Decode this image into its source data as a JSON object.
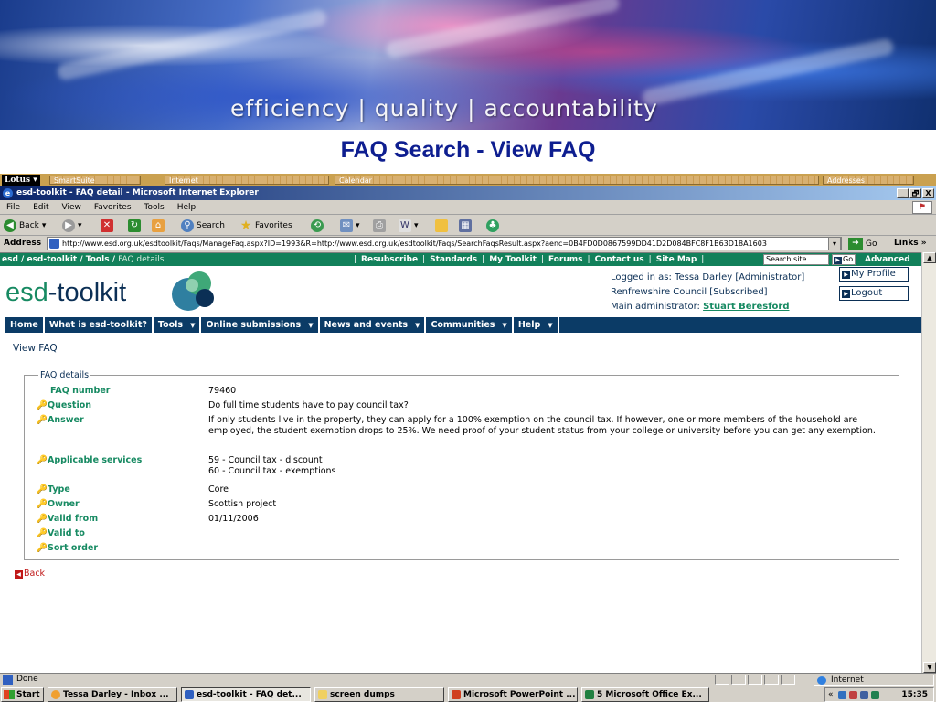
{
  "slide": {
    "tagline": "efficiency | quality | accountability",
    "title": "FAQ Search - View FAQ"
  },
  "lotus_bar": {
    "menu_label": "Lotus",
    "segments": [
      "SmartSuite",
      "Internet",
      "Calendar",
      "Addresses"
    ]
  },
  "window": {
    "title": "esd-toolkit - FAQ detail - Microsoft Internet Explorer",
    "buttons": [
      "_",
      "🗗",
      "X"
    ]
  },
  "menu": [
    "File",
    "Edit",
    "View",
    "Favorites",
    "Tools",
    "Help"
  ],
  "toolbar": {
    "back_label": "Back",
    "search_label": "Search",
    "favorites_label": "Favorites"
  },
  "address": {
    "label": "Address",
    "url": "http://www.esd.org.uk/esdtoolkit/Faqs/ManageFaq.aspx?ID=1993&R=http://www.esd.org.uk/esdtoolkit/Faqs/SearchFaqsResult.aspx?aenc=0B4FD0D0867599DD41D2D084BFC8F1B63D18A1603",
    "go_label": "Go",
    "links_label": "Links"
  },
  "site": {
    "breadcrumb": {
      "esd": "esd",
      "toolkit": "esd-toolkit",
      "tools": "Tools",
      "current": "FAQ details"
    },
    "top_links": [
      "Resubscribe",
      "Standards",
      "My Toolkit",
      "Forums",
      "Contact us",
      "Site Map"
    ],
    "search_placeholder": "Search site",
    "search_go": "Go",
    "advanced": "Advanced",
    "logo_prefix": "esd",
    "logo_suffix": "-toolkit",
    "logged_in": "Logged in as: Tessa Darley  [Administrator]",
    "council": "Renfrewshire Council  [Subscribed]",
    "main_admin_label": "Main administrator:",
    "main_admin_name": "Stuart Beresford",
    "my_profile": "My Profile",
    "logout": "Logout",
    "nav": [
      {
        "label": "Home",
        "dropdown": false
      },
      {
        "label": "What is esd-toolkit?",
        "dropdown": false
      },
      {
        "label": "Tools",
        "dropdown": true
      },
      {
        "label": "Online submissions",
        "dropdown": true
      },
      {
        "label": "News and events",
        "dropdown": true
      },
      {
        "label": "Communities",
        "dropdown": true
      },
      {
        "label": "Help",
        "dropdown": true
      }
    ],
    "page_title": "View FAQ",
    "details_legend": "FAQ details",
    "faq_number_label": "FAQ number",
    "faq_number": "79460",
    "fields": {
      "question": {
        "label": "Question",
        "value": "Do full time students have to pay council tax?"
      },
      "answer": {
        "label": "Answer",
        "value": "If only students live in the property, they can apply for a 100% exemption on the council tax. If however, one or more members of the household are employed, the student exemption drops to 25%. We need proof of your student status from your college or university before you can get any exemption."
      },
      "services": {
        "label": "Applicable services",
        "value_1": "59 - Council tax - discount",
        "value_2": "60 - Council tax - exemptions"
      },
      "type": {
        "label": "Type",
        "value": "Core"
      },
      "owner": {
        "label": "Owner",
        "value": "Scottish project"
      },
      "valid_from": {
        "label": "Valid from",
        "value": "01/11/2006"
      },
      "valid_to": {
        "label": "Valid to",
        "value": ""
      },
      "sort_order": {
        "label": "Sort order",
        "value": ""
      }
    },
    "back": "Back"
  },
  "status": {
    "text": "Done",
    "zone": "Internet"
  },
  "taskbar": {
    "start": "Start",
    "tasks": [
      "Tessa Darley - Inbox ...",
      "esd-toolkit - FAQ det...",
      "screen dumps",
      "Microsoft PowerPoint ...",
      "5 Microsoft Office Ex..."
    ],
    "clock": "15:35"
  },
  "colors": {
    "brand_green": "#12805a",
    "brand_navy": "#0b3b66",
    "slide_title": "#0e1e90"
  }
}
